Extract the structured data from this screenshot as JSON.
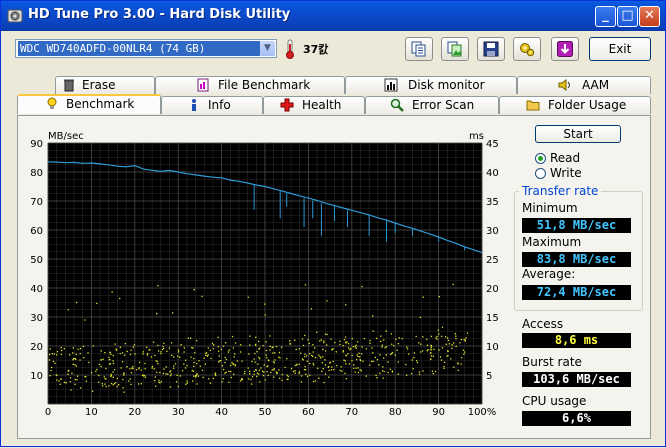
{
  "window": {
    "title": "HD Tune Pro 3.00 - Hard Disk Utility"
  },
  "toolbar": {
    "drive": "WDC WD740ADFD-00NLR4 (74 GB)",
    "temperature": "37캀",
    "exit_label": "Exit",
    "tools": [
      "copy-text-icon",
      "copy-image-icon",
      "save-icon",
      "options-icon",
      "download-icon"
    ]
  },
  "tabs": {
    "row1": [
      "Erase",
      "File Benchmark",
      "Disk monitor",
      "AAM"
    ],
    "row2": [
      "Benchmark",
      "Info",
      "Health",
      "Error Scan",
      "Folder Usage"
    ],
    "active": "Benchmark"
  },
  "controls": {
    "start_label": "Start",
    "read_label": "Read",
    "write_label": "Write",
    "selected_mode": "Read"
  },
  "results": {
    "transfer_rate_title": "Transfer rate",
    "minimum_label": "Minimum",
    "minimum_value": "51,8 MB/sec",
    "maximum_label": "Maximum",
    "maximum_value": "83,8 MB/sec",
    "average_label": "Average:",
    "average_value": "72,4 MB/sec",
    "access_label": "Access",
    "access_value": "8,6 ms",
    "burst_label": "Burst rate",
    "burst_value": "103,6 MB/sec",
    "cpu_label": "CPU usage",
    "cpu_value": "6,6%"
  },
  "chart_data": {
    "type": "line",
    "ylabel_left": "MB/sec",
    "ylabel_right": "ms",
    "x_ticks": [
      "0",
      "10",
      "20",
      "30",
      "40",
      "50",
      "60",
      "70",
      "80",
      "90",
      "100%"
    ],
    "y_left_ticks": [
      "90",
      "80",
      "70",
      "60",
      "50",
      "40",
      "30",
      "20",
      "10"
    ],
    "y_right_ticks": [
      "45",
      "40",
      "35",
      "30",
      "25",
      "20",
      "15",
      "10",
      "5"
    ],
    "xlim": [
      0,
      100
    ],
    "ylim_left": [
      0,
      90
    ],
    "ylim_right": [
      0,
      45
    ],
    "grid": true,
    "colors": {
      "background": "#000000",
      "grid": "#4a4a4a",
      "transfer": "#2e9bd6",
      "access": "#e6e62e"
    },
    "series": [
      {
        "role": "transfer",
        "x": [
          0,
          2,
          4,
          6,
          8,
          10,
          12,
          14,
          16,
          18,
          20,
          22,
          24,
          26,
          28,
          30,
          32,
          34,
          36,
          38,
          40,
          42,
          44,
          46,
          48,
          50,
          52,
          54,
          56,
          58,
          60,
          62,
          64,
          66,
          68,
          70,
          72,
          74,
          76,
          78,
          80,
          82,
          84,
          86,
          88,
          90,
          92,
          94,
          96,
          98,
          100
        ],
        "y": [
          83.5,
          83.4,
          83.2,
          83.3,
          83.0,
          83.1,
          82.8,
          82.5,
          82.0,
          81.8,
          82.2,
          81.0,
          80.6,
          80.2,
          80.5,
          80.0,
          79.4,
          79.0,
          78.6,
          78.2,
          78.0,
          77.2,
          76.8,
          76.2,
          75.5,
          75.0,
          74.2,
          73.4,
          72.6,
          71.8,
          71.0,
          70.2,
          69.2,
          68.4,
          67.6,
          66.8,
          66.0,
          65.2,
          64.2,
          63.4,
          62.4,
          61.4,
          60.6,
          59.6,
          58.6,
          57.6,
          56.4,
          55.4,
          54.2,
          53.2,
          52.2
        ]
      }
    ],
    "access_summary": {
      "typical_ms": "4–14",
      "average_ms": 8.6
    }
  }
}
